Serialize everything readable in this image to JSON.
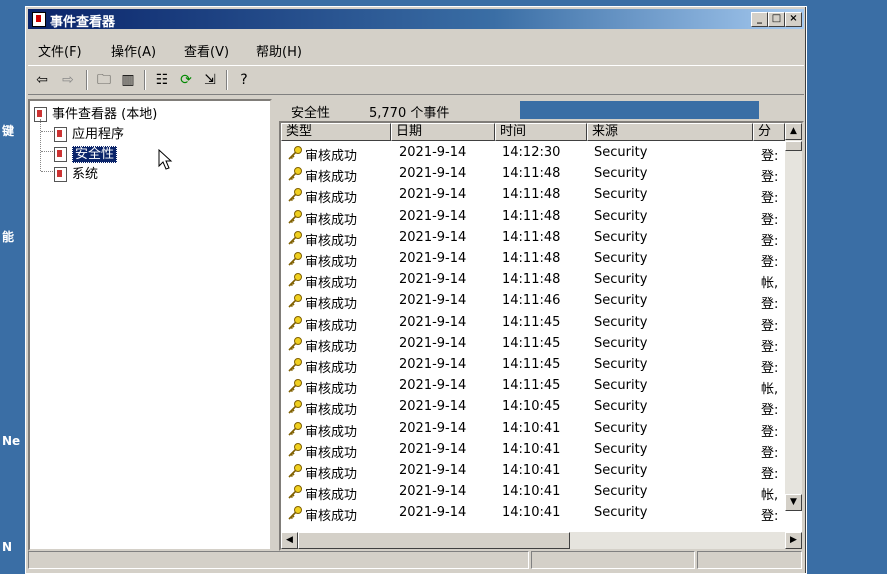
{
  "desktop": {
    "labels": [
      "键",
      "能",
      "Ne",
      "N"
    ]
  },
  "window": {
    "title": "事件查看器"
  },
  "titlebar": {
    "minimize": "_",
    "maximize": "□",
    "close": "×"
  },
  "menu": [
    "文件(F)",
    "操作(A)",
    "查看(V)",
    "帮助(H)"
  ],
  "toolbar": {
    "icons": [
      "back-arrow-icon",
      "forward-arrow-icon",
      "up-folder-icon",
      "show-hide-tree-icon",
      "properties-icon",
      "refresh-icon",
      "export-list-icon",
      "help-icon"
    ]
  },
  "tree": {
    "root": "事件查看器 (本地)",
    "items": [
      "应用程序",
      "安全性",
      "系统"
    ],
    "selected": "安全性"
  },
  "panel": {
    "name": "安全性",
    "count": "5,770 个事件"
  },
  "columns": [
    "类型",
    "日期",
    "时间",
    "来源",
    "分"
  ],
  "rows": [
    {
      "type": "审核成功",
      "date": "2021-9-14",
      "time": "14:12:30",
      "source": "Security",
      "cat": "登:"
    },
    {
      "type": "审核成功",
      "date": "2021-9-14",
      "time": "14:11:48",
      "source": "Security",
      "cat": "登:"
    },
    {
      "type": "审核成功",
      "date": "2021-9-14",
      "time": "14:11:48",
      "source": "Security",
      "cat": "登:"
    },
    {
      "type": "审核成功",
      "date": "2021-9-14",
      "time": "14:11:48",
      "source": "Security",
      "cat": "登:"
    },
    {
      "type": "审核成功",
      "date": "2021-9-14",
      "time": "14:11:48",
      "source": "Security",
      "cat": "登:"
    },
    {
      "type": "审核成功",
      "date": "2021-9-14",
      "time": "14:11:48",
      "source": "Security",
      "cat": "登:"
    },
    {
      "type": "审核成功",
      "date": "2021-9-14",
      "time": "14:11:48",
      "source": "Security",
      "cat": "帐,"
    },
    {
      "type": "审核成功",
      "date": "2021-9-14",
      "time": "14:11:46",
      "source": "Security",
      "cat": "登:"
    },
    {
      "type": "审核成功",
      "date": "2021-9-14",
      "time": "14:11:45",
      "source": "Security",
      "cat": "登:"
    },
    {
      "type": "审核成功",
      "date": "2021-9-14",
      "time": "14:11:45",
      "source": "Security",
      "cat": "登:"
    },
    {
      "type": "审核成功",
      "date": "2021-9-14",
      "time": "14:11:45",
      "source": "Security",
      "cat": "登:"
    },
    {
      "type": "审核成功",
      "date": "2021-9-14",
      "time": "14:11:45",
      "source": "Security",
      "cat": "帐,"
    },
    {
      "type": "审核成功",
      "date": "2021-9-14",
      "time": "14:10:45",
      "source": "Security",
      "cat": "登:"
    },
    {
      "type": "审核成功",
      "date": "2021-9-14",
      "time": "14:10:41",
      "source": "Security",
      "cat": "登:"
    },
    {
      "type": "审核成功",
      "date": "2021-9-14",
      "time": "14:10:41",
      "source": "Security",
      "cat": "登:"
    },
    {
      "type": "审核成功",
      "date": "2021-9-14",
      "time": "14:10:41",
      "source": "Security",
      "cat": "登:"
    },
    {
      "type": "审核成功",
      "date": "2021-9-14",
      "time": "14:10:41",
      "source": "Security",
      "cat": "帐,"
    },
    {
      "type": "审核成功",
      "date": "2021-9-14",
      "time": "14:10:41",
      "source": "Security",
      "cat": "登:"
    }
  ],
  "colors": {
    "titlebar": "#0a246a",
    "desktop": "#3a6ea5",
    "selection": "#0a246a"
  }
}
